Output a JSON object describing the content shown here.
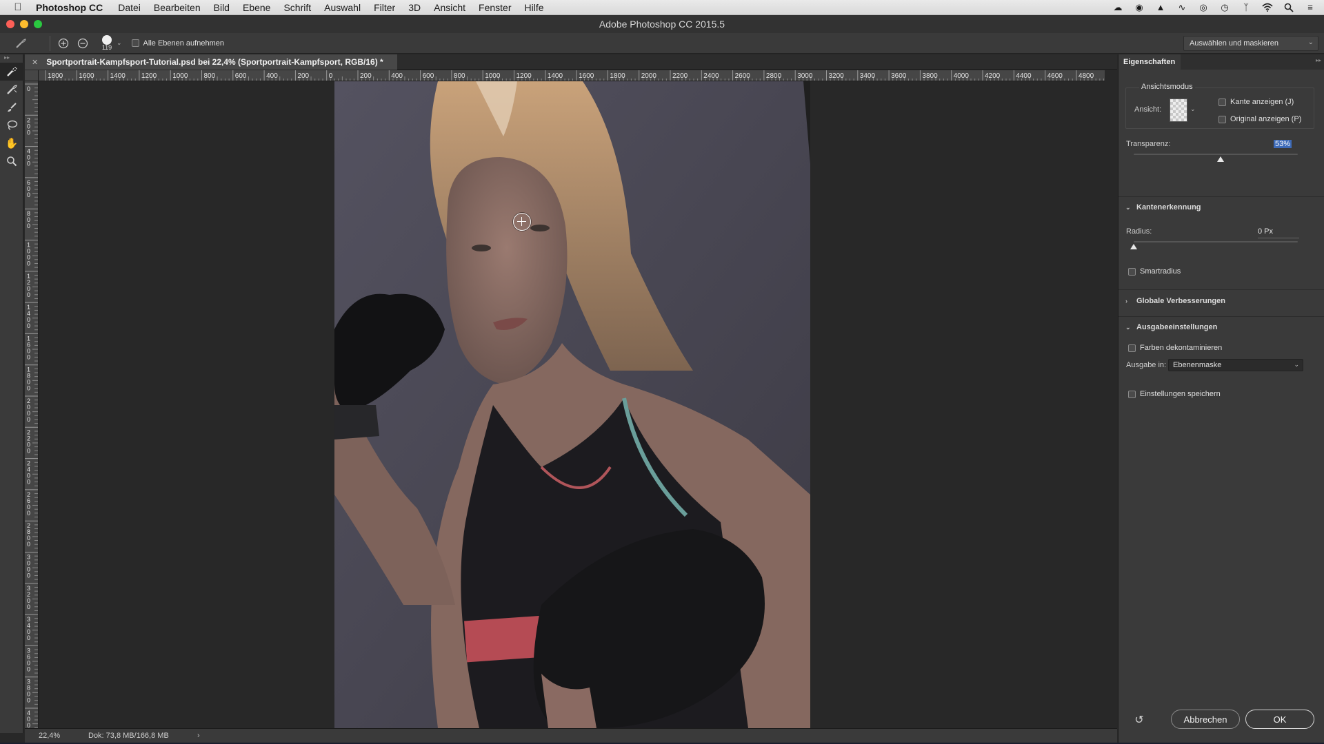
{
  "menubar": {
    "app_name": "Photoshop CC",
    "items": [
      "Datei",
      "Bearbeiten",
      "Bild",
      "Ebene",
      "Schrift",
      "Auswahl",
      "Filter",
      "3D",
      "Ansicht",
      "Fenster",
      "Hilfe"
    ],
    "tray_icons": [
      "creative-cloud-icon",
      "eye-icon",
      "adobe-icon",
      "script-icon",
      "record-icon",
      "time-machine-icon",
      "bluetooth-icon",
      "wifi-icon",
      "spotlight-icon",
      "notification-list-icon"
    ]
  },
  "window": {
    "title": "Adobe Photoshop CC 2015.5"
  },
  "options_bar": {
    "brush_size": "119",
    "all_layers_label": "Alle Ebenen aufnehmen",
    "select_mask_label": "Auswählen und maskieren"
  },
  "toolbox": {
    "tools": [
      "quick-selection-icon",
      "refine-edge-brush-icon",
      "brush-icon",
      "lasso-icon",
      "hand-icon",
      "zoom-icon"
    ]
  },
  "document": {
    "tab_title": "Sportportrait-Kampfsport-Tutorial.psd bei 22,4% (Sportportrait-Kampfsport, RGB/16) *",
    "ruler_h": [
      "1800",
      "1600",
      "1400",
      "1200",
      "1000",
      "800",
      "600",
      "400",
      "200",
      "0",
      "200",
      "400",
      "600",
      "800",
      "1000",
      "1200",
      "1400",
      "1600",
      "1800",
      "2000",
      "2200",
      "2400",
      "2600",
      "2800",
      "3000",
      "3200",
      "3400",
      "3600",
      "3800",
      "4000",
      "4200",
      "4400",
      "4600",
      "4800"
    ],
    "ruler_v": [
      "0",
      "200",
      "400",
      "600",
      "800",
      "1000",
      "1200",
      "1400",
      "1600",
      "1800",
      "2000",
      "2200",
      "2400",
      "2600",
      "2800",
      "3000",
      "3200",
      "3400",
      "3600",
      "3800",
      "4000"
    ]
  },
  "status": {
    "zoom": "22,4%",
    "doc_size": "Dok: 73,8 MB/166,8 MB"
  },
  "panel": {
    "tab": "Eigenschaften",
    "view_mode_title": "Ansichtsmodus",
    "view_label": "Ansicht:",
    "show_edge": "Kante anzeigen (J)",
    "show_original": "Original anzeigen (P)",
    "transparency_label": "Transparenz:",
    "transparency_value": "53%",
    "transparency_fraction": 0.53,
    "edge_detection": "Kantenerkennung",
    "radius_label": "Radius:",
    "radius_value": "0 Px",
    "radius_fraction": 0,
    "smart_radius": "Smartradius",
    "global_refinements": "Globale Verbesserungen",
    "output_settings": "Ausgabeeinstellungen",
    "decontaminate": "Farben dekontaminieren",
    "output_to_label": "Ausgabe in:",
    "output_to_value": "Ebenenmaske",
    "remember_settings": "Einstellungen speichern",
    "cancel": "Abbrechen",
    "ok": "OK"
  }
}
